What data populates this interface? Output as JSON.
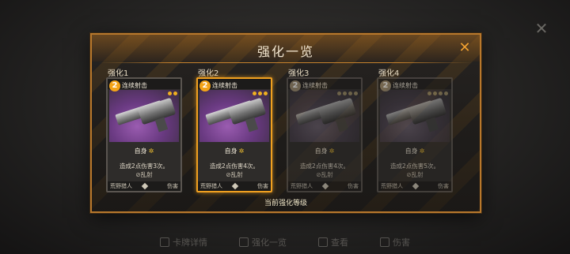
{
  "modal": {
    "title": "强化一览",
    "current_level_label": "当前强化等级"
  },
  "cards": [
    {
      "slot_label": "强化1",
      "cost": "2",
      "name": "连续射击",
      "target": "自身",
      "desc_line1": "造成2点伤害3次。",
      "desc_line2": "乱射",
      "footer_left": "荒野猎人",
      "footer_right": "伤害",
      "pips": 2,
      "state": "normal"
    },
    {
      "slot_label": "强化2",
      "cost": "2",
      "name": "连续射击",
      "target": "自身",
      "desc_line1": "造成2点伤害4次。",
      "desc_line2": "乱射",
      "footer_left": "荒野猎人",
      "footer_right": "伤害",
      "pips": 3,
      "state": "current"
    },
    {
      "slot_label": "强化3",
      "cost": "2",
      "name": "连续射击",
      "target": "自身",
      "desc_line1": "造成2点伤害4次。",
      "desc_line2": "乱射",
      "footer_left": "荒野猎人",
      "footer_right": "伤害",
      "pips": 4,
      "state": "locked"
    },
    {
      "slot_label": "强化4",
      "cost": "2",
      "name": "连续射击",
      "target": "自身",
      "desc_line1": "造成2点伤害5次。",
      "desc_line2": "乱射",
      "footer_left": "荒野猎人",
      "footer_right": "伤害",
      "pips": 4,
      "state": "locked"
    }
  ],
  "bottom_bar": {
    "items": [
      "卡牌详情",
      "强化一览",
      "查看",
      "伤害"
    ]
  },
  "colors": {
    "accent": "#f0a020",
    "border": "#b8782c",
    "art_purple": "#6a3a82"
  },
  "icons": {
    "close": "close-icon",
    "diamond": "diamond-icon",
    "star": "star-icon"
  }
}
